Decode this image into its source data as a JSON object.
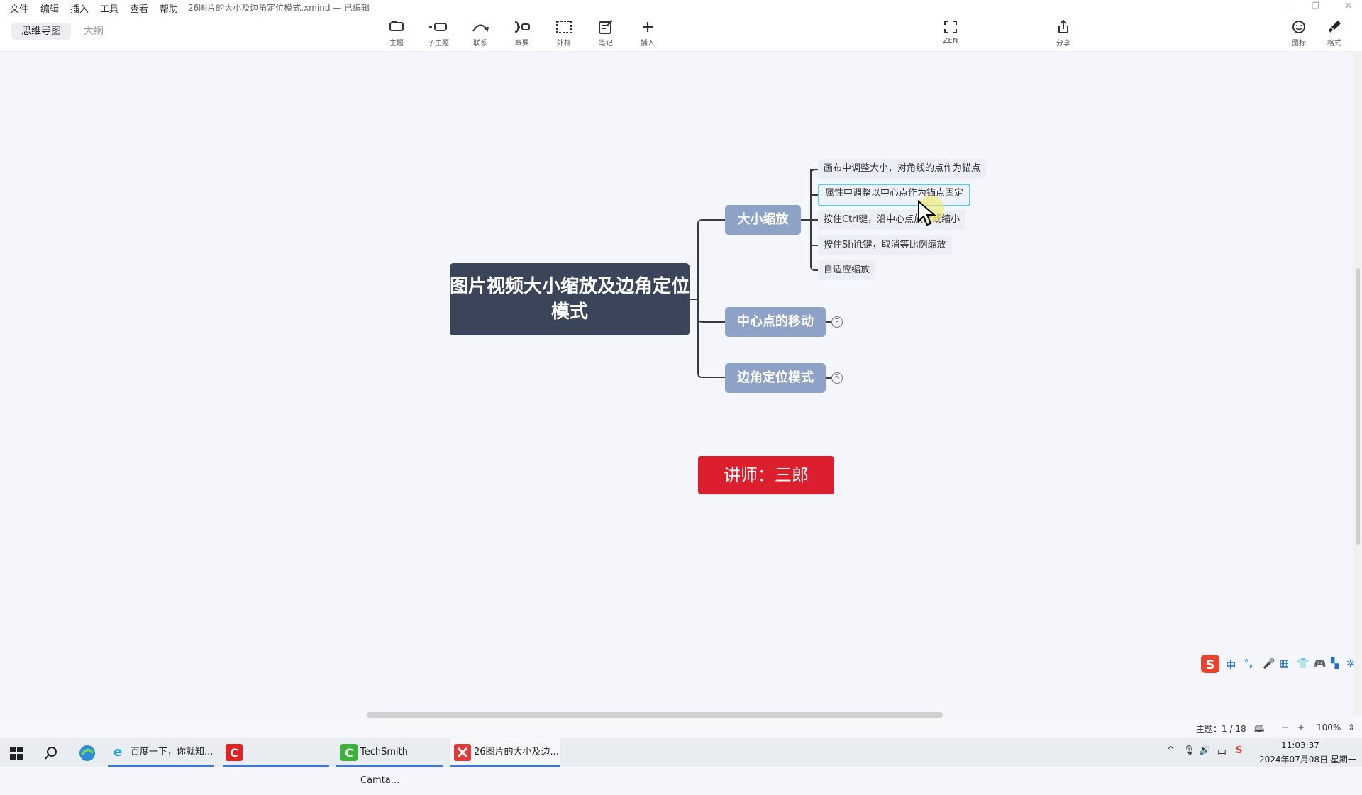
{
  "menu": {
    "items": [
      "文件",
      "编辑",
      "插入",
      "工具",
      "查看",
      "帮助"
    ],
    "doc_title": "26图片的大小及边角定位模式.xmind — 已编辑"
  },
  "view_tabs": {
    "mindmap": "思维导图",
    "outline": "大纲"
  },
  "toolbar": {
    "topic": "主题",
    "subtopic": "子主题",
    "relationship": "联系",
    "summary": "概要",
    "boundary": "外框",
    "note": "笔记",
    "insert": "插入",
    "zen": "ZEN",
    "share": "分享",
    "icon": "图标",
    "format": "格式"
  },
  "mindmap": {
    "root": "图片视频大小缩放及边角定位模式",
    "branches": [
      {
        "label": "大小缩放",
        "children": [
          "画布中调整大小，对角线的点作为锚点",
          "属性中调整以中心点作为锚点固定",
          "按住Ctrl键，沿中心点放大或缩小",
          "按住Shift键，取消等比例缩放",
          "自适应缩放"
        ]
      },
      {
        "label": "中心点的移动",
        "collapsed_count": "2"
      },
      {
        "label": "边角定位模式",
        "collapsed_count": "6"
      }
    ],
    "floating_topic": "讲师：三郎"
  },
  "ime": {
    "mode": "中",
    "punct": "°,"
  },
  "status": {
    "topic_count": "主题：1 / 18",
    "zoom": "100%"
  },
  "taskbar": {
    "browser": "百度一下，你就知...",
    "camtasia": "TechSmith Camta...",
    "xmind": "26图片的大小及边...",
    "time": "11:03:37",
    "date": "2024年07月08日 星期一",
    "tray_lang": "中"
  },
  "colors": {
    "root_bg": "#3a4559",
    "branch_bg": "#8ea2c7",
    "teacher_bg": "#dc1f2e",
    "selection": "#6cc7e7"
  }
}
